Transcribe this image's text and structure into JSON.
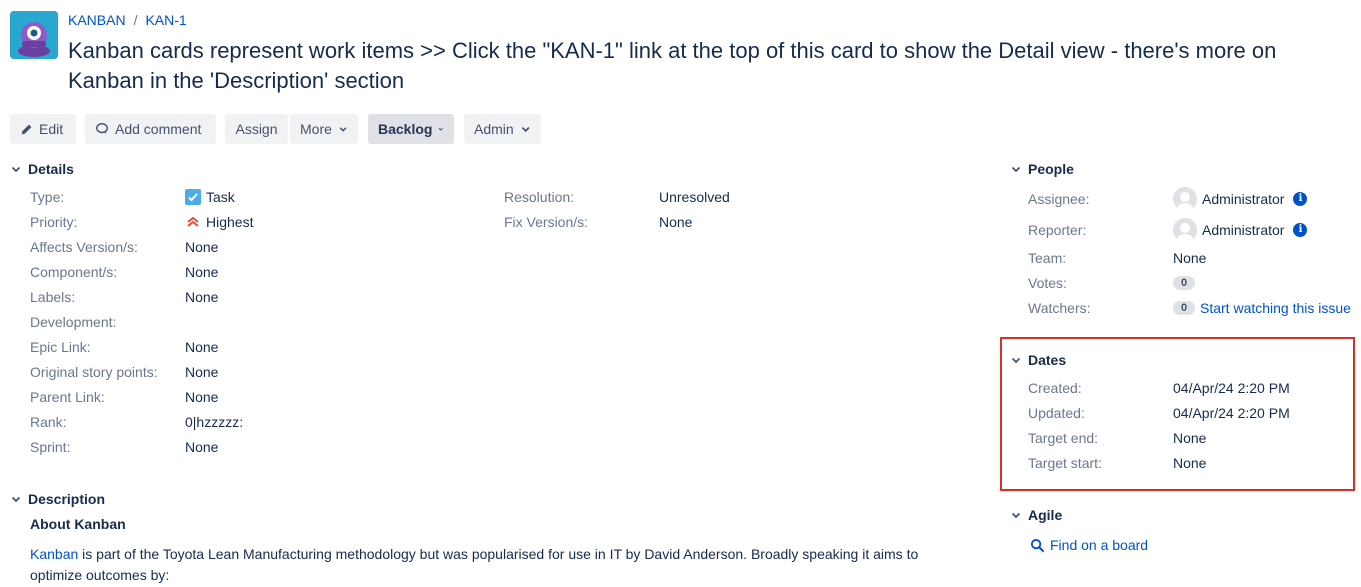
{
  "breadcrumb": {
    "project": "KANBAN",
    "separator": "/",
    "issue_key": "KAN-1"
  },
  "summary": "Kanban cards represent work items >> Click the \"KAN-1\" link at the top of this card to show the Detail view - there's more on Kanban in the 'Description' section",
  "toolbar": {
    "edit": "Edit",
    "add_comment": "Add comment",
    "assign": "Assign",
    "more": "More",
    "status": "Backlog",
    "admin": "Admin"
  },
  "details": {
    "title": "Details",
    "left": [
      {
        "label": "Type:",
        "value": "Task"
      },
      {
        "label": "Priority:",
        "value": "Highest"
      },
      {
        "label": "Affects Version/s:",
        "value": "None"
      },
      {
        "label": "Component/s:",
        "value": "None"
      },
      {
        "label": "Labels:",
        "value": "None"
      },
      {
        "label": "Development:",
        "value": ""
      },
      {
        "label": "Epic Link:",
        "value": "None"
      },
      {
        "label": "Original story points:",
        "value": "None"
      },
      {
        "label": "Parent Link:",
        "value": "None"
      },
      {
        "label": "Rank:",
        "value": "0|hzzzzz:"
      },
      {
        "label": "Sprint:",
        "value": "None"
      }
    ],
    "right": [
      {
        "label": "Resolution:",
        "value": "Unresolved"
      },
      {
        "label": "Fix Version/s:",
        "value": "None"
      }
    ]
  },
  "people": {
    "title": "People",
    "assignee_label": "Assignee:",
    "assignee": "Administrator",
    "reporter_label": "Reporter:",
    "reporter": "Administrator",
    "team_label": "Team:",
    "team": "None",
    "votes_label": "Votes:",
    "votes": "0",
    "watchers_label": "Watchers:",
    "watchers": "0",
    "watch_link": "Start watching this issue"
  },
  "dates": {
    "title": "Dates",
    "created_label": "Created:",
    "created": "04/Apr/24 2:20 PM",
    "updated_label": "Updated:",
    "updated": "04/Apr/24 2:20 PM",
    "target_end_label": "Target end:",
    "target_end": "None",
    "target_start_label": "Target start:",
    "target_start": "None"
  },
  "agile": {
    "title": "Agile",
    "find_link": "Find on a board"
  },
  "description": {
    "title": "Description",
    "heading": "About Kanban",
    "link": "Kanban",
    "text": " is part of the Toyota Lean Manufacturing methodology but was popularised for use in IT by David Anderson. Broadly speaking it aims to optimize outcomes by:"
  },
  "colors": {
    "link": "#0052cc",
    "highlight": "#d93025",
    "priority_highest": "#e5493a",
    "task_icon": "#4bade8"
  }
}
